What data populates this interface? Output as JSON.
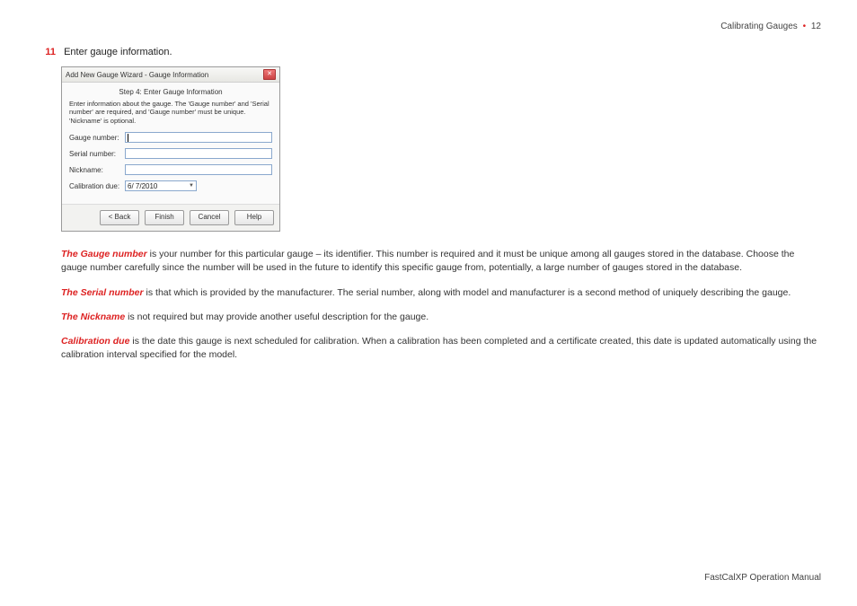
{
  "header": {
    "section": "Calibrating Gauges",
    "page": "12"
  },
  "step": {
    "number": "11",
    "text": "Enter gauge information."
  },
  "dialog": {
    "title": "Add New Gauge Wizard - Gauge Information",
    "step_title": "Step 4: Enter Gauge Information",
    "instruction": "Enter information about the gauge. The 'Gauge number' and 'Serial number' are required, and 'Gauge number' must be unique. 'Nickname' is optional.",
    "fields": {
      "gauge_number_label": "Gauge number:",
      "gauge_number_value": "",
      "serial_number_label": "Serial number:",
      "serial_number_value": "",
      "nickname_label": "Nickname:",
      "nickname_value": "",
      "calibration_due_label": "Calibration due:",
      "calibration_due_value": "6/ 7/2010"
    },
    "buttons": {
      "back": "< Back",
      "finish": "Finish",
      "cancel": "Cancel",
      "help": "Help"
    }
  },
  "paragraphs": {
    "gauge_number_term": "The Gauge number",
    "gauge_number_text": " is your number for this particular gauge – its identifier. This number is required and it must be unique among all gauges stored in the database. Choose the gauge number carefully since the number will be used in the future to identify this specific gauge from, potentially, a large number of gauges stored in the database.",
    "serial_number_term": "The Serial number",
    "serial_number_text": " is that which is provided by the manufacturer. The serial number, along with model and manufacturer is a second method of uniquely describing the gauge.",
    "nickname_term": "The Nickname",
    "nickname_text": " is not required but may provide another useful description for the gauge.",
    "calibration_due_term": "Calibration due",
    "calibration_due_text": " is the date this gauge is next scheduled for calibration. When a calibration has been completed and a certificate created, this date is updated automatically using the calibration interval specified for the model."
  },
  "footer": {
    "text": "FastCalXP Operation Manual"
  }
}
